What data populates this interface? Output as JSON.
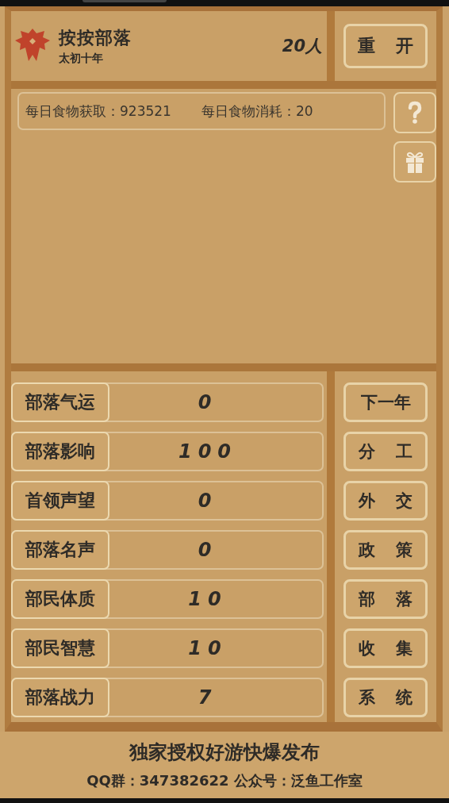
{
  "header": {
    "title": "按按部落",
    "subtitle": "太初十年",
    "population": "20人",
    "restart_button": "重 开"
  },
  "food": {
    "income": "每日食物获取：923521",
    "consumption": "每日食物消耗：20"
  },
  "side_buttons": [
    {
      "kind": "help"
    },
    {
      "kind": "gift"
    }
  ],
  "stats": [
    {
      "label": "部落气运",
      "value": "0"
    },
    {
      "label": "部落影响",
      "value": "100"
    },
    {
      "label": "首领声望",
      "value": "0"
    },
    {
      "label": "部落名声",
      "value": "0"
    },
    {
      "label": "部民体质",
      "value": "10"
    },
    {
      "label": "部民智慧",
      "value": "10"
    },
    {
      "label": "部落战力",
      "value": "7"
    }
  ],
  "actions": [
    "下一年",
    "分 工",
    "外 交",
    "政 策",
    "部 落",
    "收 集",
    "系 统"
  ],
  "footer": {
    "publisher": "独家授权好游快爆发布",
    "contact": "QQ群：347382622 公众号：泛鱼工作室"
  }
}
